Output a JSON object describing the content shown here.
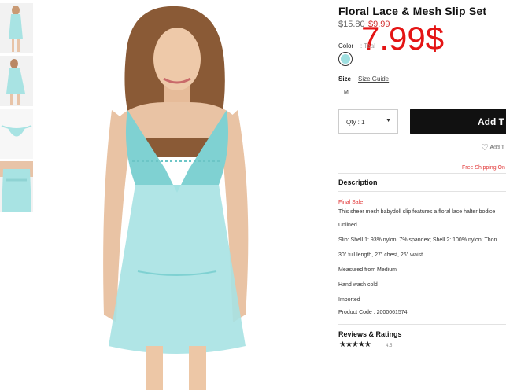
{
  "product": {
    "title": "Floral Lace & Mesh Slip Set",
    "price_original": "$15.80",
    "price_sale": "$9.99",
    "overlay_price": "7.99$"
  },
  "color": {
    "label": "Color",
    "value": ": Teal",
    "swatch_color": "#9edfe0"
  },
  "size": {
    "label": "Size",
    "guide_label": "Size Guide",
    "options": [
      "M"
    ]
  },
  "quantity": {
    "label": "Qty : 1"
  },
  "actions": {
    "add_label": "Add T",
    "wishlist_label": "Add T"
  },
  "shipping": {
    "text": "Free Shipping On"
  },
  "description": {
    "heading": "Description",
    "final_sale": "Final Sale",
    "lines": [
      "This sheer mesh babydoll slip features a floral lace halter bodice",
      "Unlined",
      "Slip: Shell 1: 93% nylon, 7% spandex; Shell 2: 100% nylon; Thon",
      "30\" full length, 27\" chest, 26\" waist",
      "Measured from Medium",
      "Hand wash cold",
      "Imported",
      "Product Code : 2000061574"
    ]
  },
  "reviews": {
    "heading": "Reviews & Ratings",
    "stars": "★★★★★",
    "rating": "4.5"
  },
  "colors": {
    "accent_red": "#e41414",
    "button_bg": "#111111",
    "garment": "#9edfe0"
  }
}
